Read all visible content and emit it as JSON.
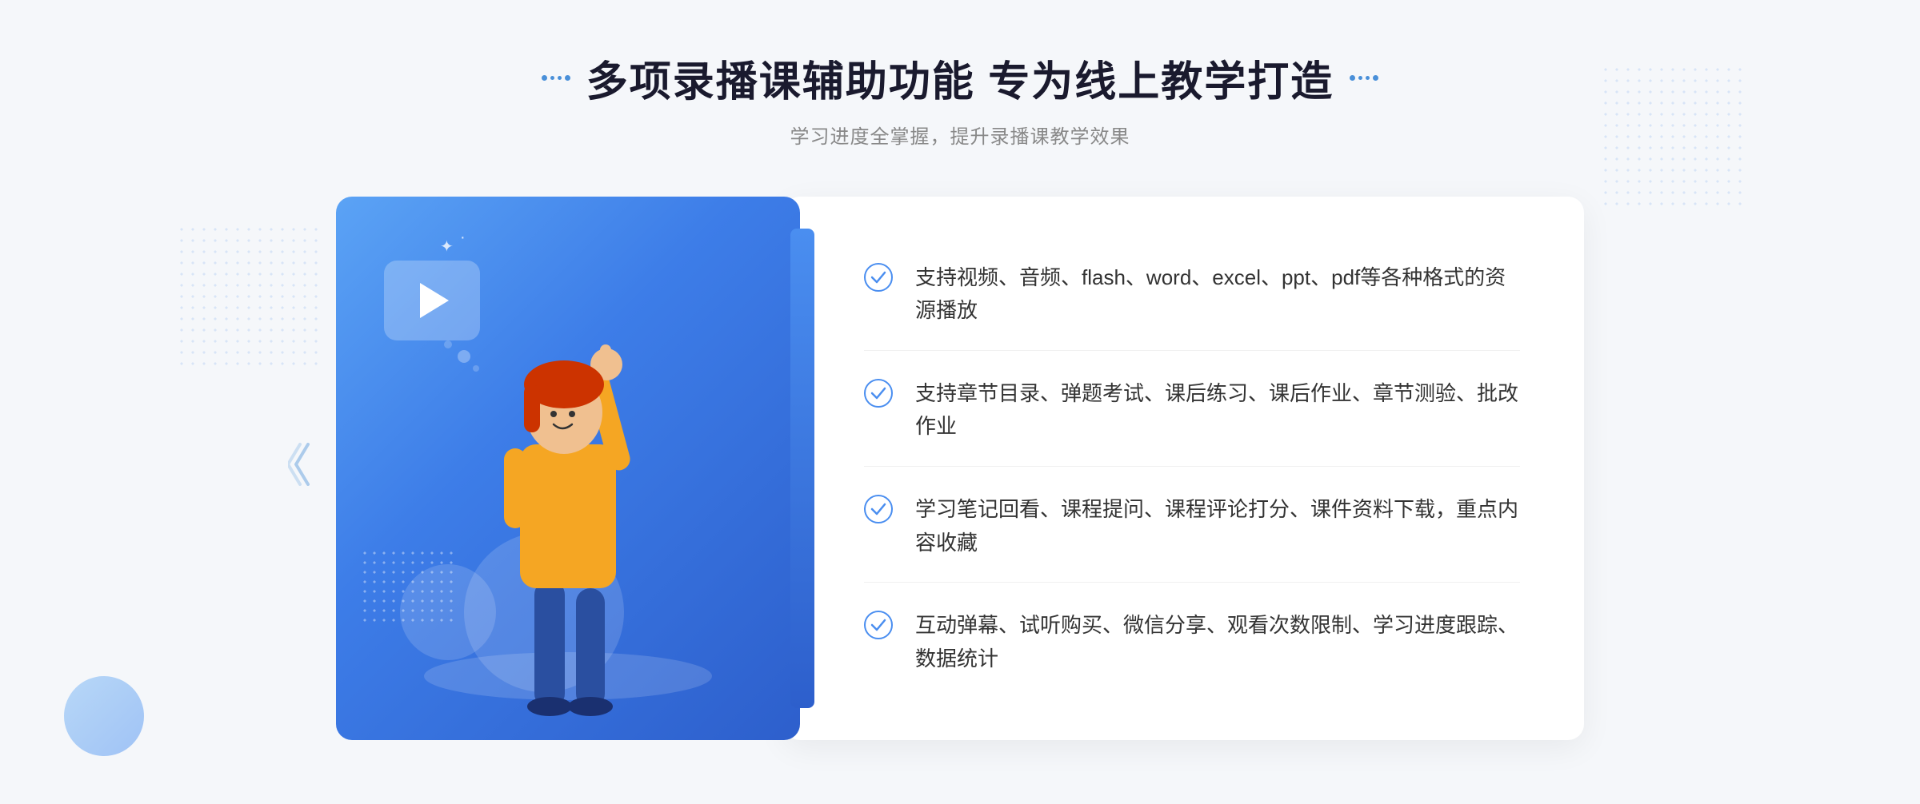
{
  "header": {
    "title": "多项录播课辅助功能 专为线上教学打造",
    "subtitle": "学习进度全掌握，提升录播课教学效果",
    "title_dots_left": "decorative",
    "title_dots_right": "decorative"
  },
  "features": [
    {
      "id": 1,
      "text": "支持视频、音频、flash、word、excel、ppt、pdf等各种格式的资源播放"
    },
    {
      "id": 2,
      "text": "支持章节目录、弹题考试、课后练习、课后作业、章节测验、批改作业"
    },
    {
      "id": 3,
      "text": "学习笔记回看、课程提问、课程评论打分、课件资料下载，重点内容收藏"
    },
    {
      "id": 4,
      "text": "互动弹幕、试听购买、微信分享、观看次数限制、学习进度跟踪、数据统计"
    }
  ],
  "colors": {
    "accent_blue": "#4a8ef0",
    "gradient_start": "#5ba3f5",
    "gradient_end": "#2d5fcc",
    "title_color": "#1a1a2e",
    "text_color": "#333333",
    "subtitle_color": "#888888",
    "check_color": "#4a8ef0"
  }
}
